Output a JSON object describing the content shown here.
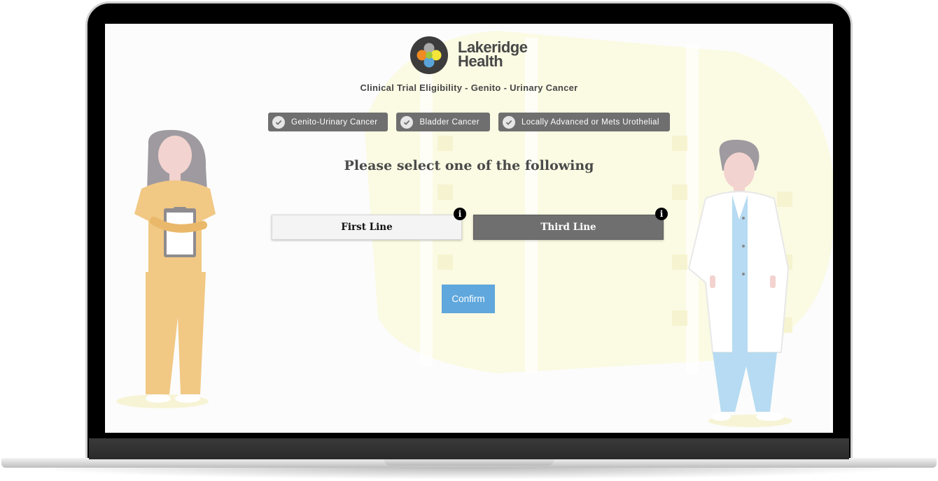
{
  "brand": {
    "name_line1": "Lakeridge",
    "name_line2": "Health"
  },
  "app_title": "Clinical Trial Eligibility - Genito - Urinary Cancer",
  "breadcrumb": [
    {
      "label": "Genito-Urinary Cancer",
      "icon": "check-icon"
    },
    {
      "label": "Bladder Cancer",
      "icon": "check-icon"
    },
    {
      "label": "Locally Advanced or Mets Urothelial",
      "icon": "check-icon"
    }
  ],
  "prompt": "Please select one of the following",
  "options": [
    {
      "label": "First Line",
      "info_icon": "i",
      "selected": false
    },
    {
      "label": "Third Line",
      "info_icon": "i",
      "selected": true
    }
  ],
  "confirm_label": "Confirm",
  "colors": {
    "chip_bg": "#6f6f6f",
    "selected_option_bg": "#6f6f6f",
    "confirm_bg": "#5fa7dc",
    "text_dark": "#474747",
    "logo_bg": "#3c3c3c"
  }
}
